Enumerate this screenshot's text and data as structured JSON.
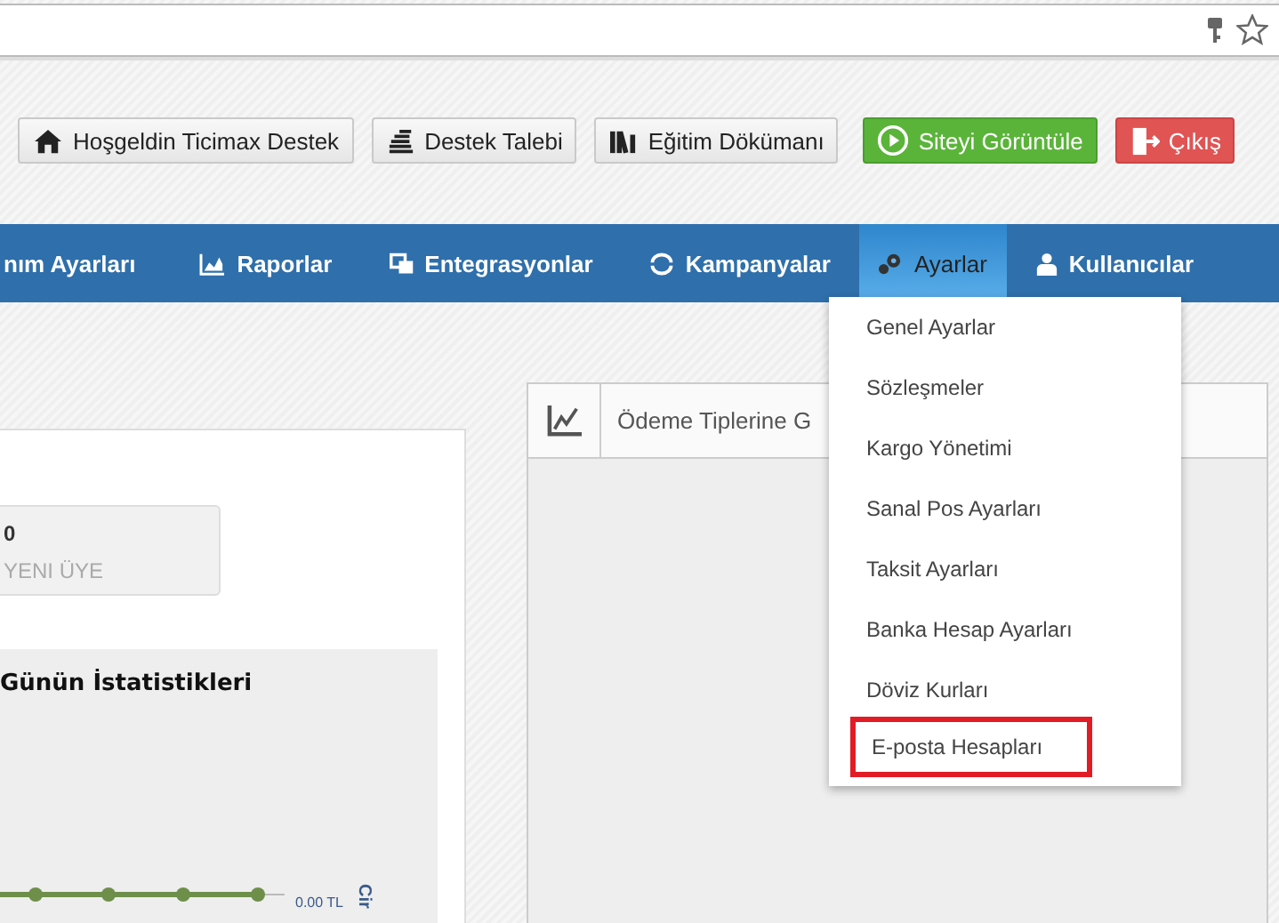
{
  "toolbar_buttons": [
    {
      "label": "Hoşgeldin Ticimax Destek",
      "kind": "home"
    },
    {
      "label": "Destek Talebi",
      "kind": "support"
    },
    {
      "label": "Eğitim Dökümanı",
      "kind": "docs"
    },
    {
      "label": "Siteyi Görüntüle",
      "kind": "view"
    },
    {
      "label": "Çıkış",
      "kind": "exit"
    }
  ],
  "nav": [
    {
      "label": "nım Ayarları",
      "kind": "none",
      "selected": false
    },
    {
      "label": "Raporlar",
      "kind": "chart",
      "selected": false
    },
    {
      "label": "Entegrasyonlar",
      "kind": "layers",
      "selected": false
    },
    {
      "label": "Kampanyalar",
      "kind": "cycle",
      "selected": false
    },
    {
      "label": "Ayarlar",
      "kind": "gears",
      "selected": true
    },
    {
      "label": "Kullanıcılar",
      "kind": "user",
      "selected": false
    }
  ],
  "dropdown": [
    {
      "label": "Genel Ayarlar",
      "highlighted": false
    },
    {
      "label": "Sözleşmeler",
      "highlighted": false
    },
    {
      "label": "Kargo Yönetimi",
      "highlighted": false
    },
    {
      "label": "Sanal Pos Ayarları",
      "highlighted": false
    },
    {
      "label": "Taksit Ayarları",
      "highlighted": false
    },
    {
      "label": "Banka Hesap Ayarları",
      "highlighted": false
    },
    {
      "label": "Döviz Kurları",
      "highlighted": false
    },
    {
      "label": "E-posta Hesapları",
      "highlighted": true
    }
  ],
  "stat": {
    "value": "0",
    "label": "YENI ÜYE"
  },
  "stats_chart": {
    "title": "Günün İstatistikleri",
    "value_label": "0.00 TL",
    "axis_label": "Cir"
  },
  "payment_panel": {
    "title": "Ödeme Tiplerine G"
  }
}
